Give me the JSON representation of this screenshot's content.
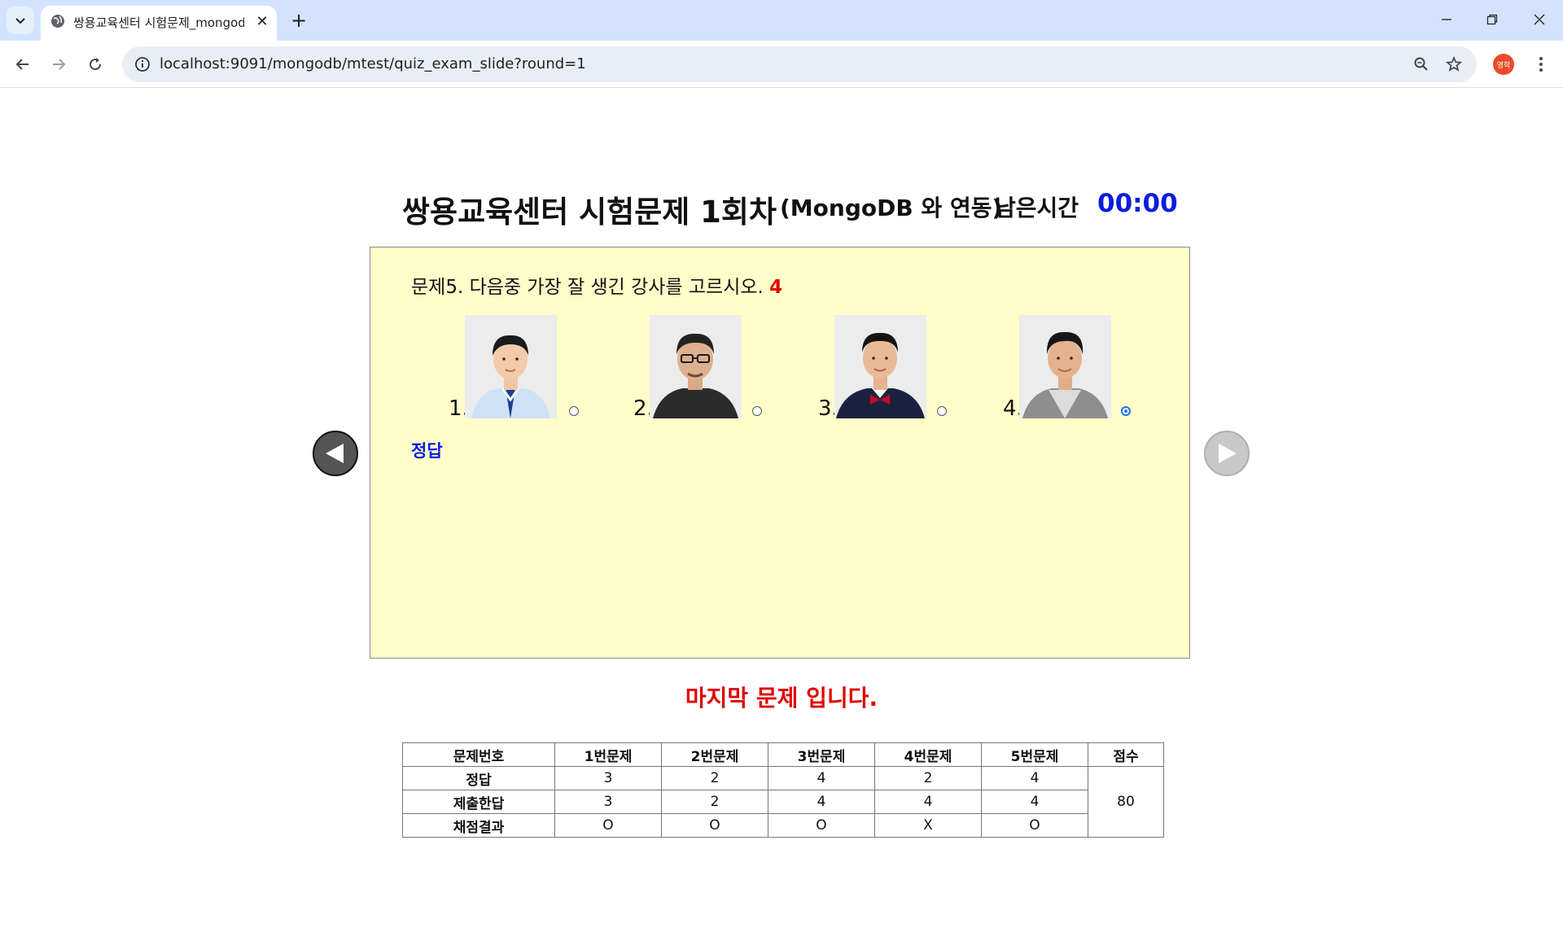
{
  "browser": {
    "tab_title": "쌍용교육센터 시험문제_mongodb",
    "tab_close": "✕",
    "new_tab": "+",
    "url": "localhost:9091/mongodb/mtest/quiz_exam_slide?round=1",
    "profile_label": "영학"
  },
  "header": {
    "title": "쌍용교육센터 시험문제 1회차",
    "subtitle": "(MongoDB 와 연동)",
    "time_label": "남은시간",
    "time_value": "00:00"
  },
  "quiz": {
    "question": "문제5. 다음중 가장 잘 생긴 강사를 고르시오.",
    "selected_answer": "4",
    "options": [
      {
        "num": "1.",
        "checked": false
      },
      {
        "num": "2.",
        "checked": false
      },
      {
        "num": "3.",
        "checked": false
      },
      {
        "num": "4.",
        "checked": true
      }
    ],
    "answer_label": "정답"
  },
  "last_message": "마지막 문제 입니다.",
  "score_table": {
    "headers": [
      "문제번호",
      "1번문제",
      "2번문제",
      "3번문제",
      "4번문제",
      "5번문제",
      "점수"
    ],
    "rows": [
      {
        "label": "정답",
        "cells": [
          "3",
          "2",
          "4",
          "2",
          "4"
        ]
      },
      {
        "label": "제출한답",
        "cells": [
          "3",
          "2",
          "4",
          "4",
          "4"
        ]
      },
      {
        "label": "채점결과",
        "cells": [
          "O",
          "O",
          "O",
          "X",
          "O"
        ]
      }
    ],
    "score": "80"
  },
  "colors": {
    "box_bg": "#fffdc9",
    "timer": "#0a1de0",
    "alert": "#e00000"
  }
}
